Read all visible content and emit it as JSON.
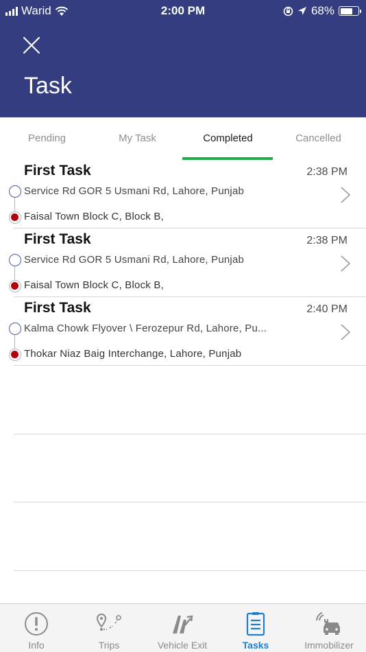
{
  "status_bar": {
    "carrier": "Warid",
    "time": "2:00 PM",
    "battery": "68%",
    "battery_level": 0.68
  },
  "header": {
    "title": "Task",
    "close_icon": "close-icon"
  },
  "tabs": [
    {
      "label": "Pending",
      "active": false
    },
    {
      "label": "My Task",
      "active": false
    },
    {
      "label": "Completed",
      "active": true
    },
    {
      "label": "Cancelled",
      "active": false
    }
  ],
  "tasks": [
    {
      "title": "First Task",
      "time": "2:38 PM",
      "pickup": "Service Rd GOR 5 Usmani Rd, Lahore, Punjab",
      "dropoff": "Faisal Town Block C, Block B,"
    },
    {
      "title": "First Task",
      "time": "2:38 PM",
      "pickup": "Service Rd GOR 5 Usmani Rd, Lahore, Punjab",
      "dropoff": "Faisal Town Block C, Block B,"
    },
    {
      "title": "First Task",
      "time": "2:40 PM",
      "pickup": "Kalma Chowk Flyover \\ Ferozepur Rd, Lahore, Pu...",
      "dropoff": "Thokar Niaz Baig Interchange, Lahore, Punjab"
    }
  ],
  "bottom_nav": [
    {
      "label": "Info",
      "icon": "info-icon",
      "active": false
    },
    {
      "label": "Trips",
      "icon": "trips-route-icon",
      "active": false
    },
    {
      "label": "Vehicle Exit",
      "icon": "vehicle-exit-icon",
      "active": false
    },
    {
      "label": "Tasks",
      "icon": "tasks-icon",
      "active": true
    },
    {
      "label": "Immobilizer",
      "icon": "immobilizer-icon",
      "active": false
    }
  ],
  "colors": {
    "header_bg": "#343d80",
    "active_tab_indicator": "#1fae4a",
    "dropoff_dot": "#b1000e",
    "active_nav": "#1a7fd0"
  }
}
